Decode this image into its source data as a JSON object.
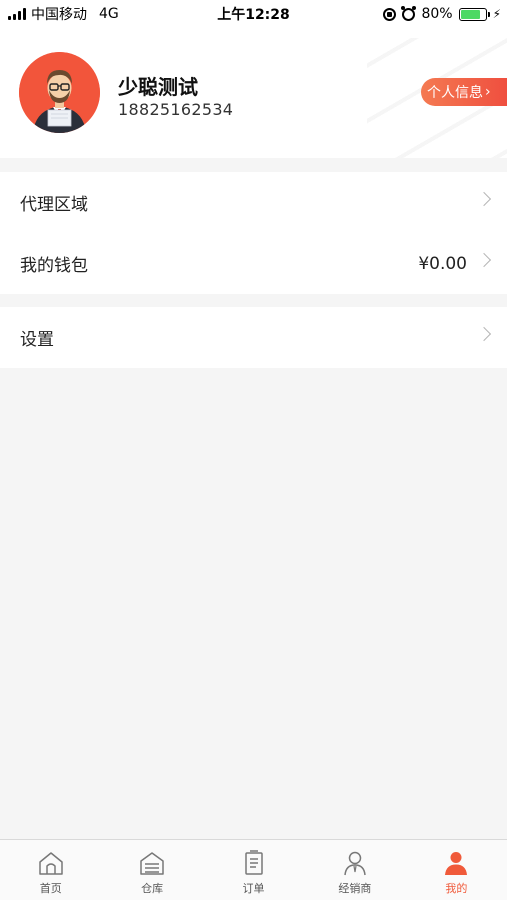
{
  "status_bar": {
    "carrier": "中国移动",
    "network": "4G",
    "time": "上午12:28",
    "battery": "80%",
    "battery_level": 0.8
  },
  "profile": {
    "name": "少聪测试",
    "phone": "18825162534",
    "info_button": "个人信息"
  },
  "menu": {
    "group1": [
      {
        "label": "代理区域",
        "value": ""
      },
      {
        "label": "我的钱包",
        "value": "¥0.00"
      }
    ],
    "group2": [
      {
        "label": "设置",
        "value": ""
      }
    ]
  },
  "tabbar": {
    "items": [
      {
        "label": "首页",
        "icon": "home-icon",
        "active": false
      },
      {
        "label": "仓库",
        "icon": "warehouse-icon",
        "active": false
      },
      {
        "label": "订单",
        "icon": "order-icon",
        "active": false
      },
      {
        "label": "经销商",
        "icon": "dealer-icon",
        "active": false
      },
      {
        "label": "我的",
        "icon": "profile-icon",
        "active": true
      }
    ]
  },
  "colors": {
    "accent": "#f05a3a",
    "background": "#f5f5f5",
    "battery": "#4cd964"
  }
}
